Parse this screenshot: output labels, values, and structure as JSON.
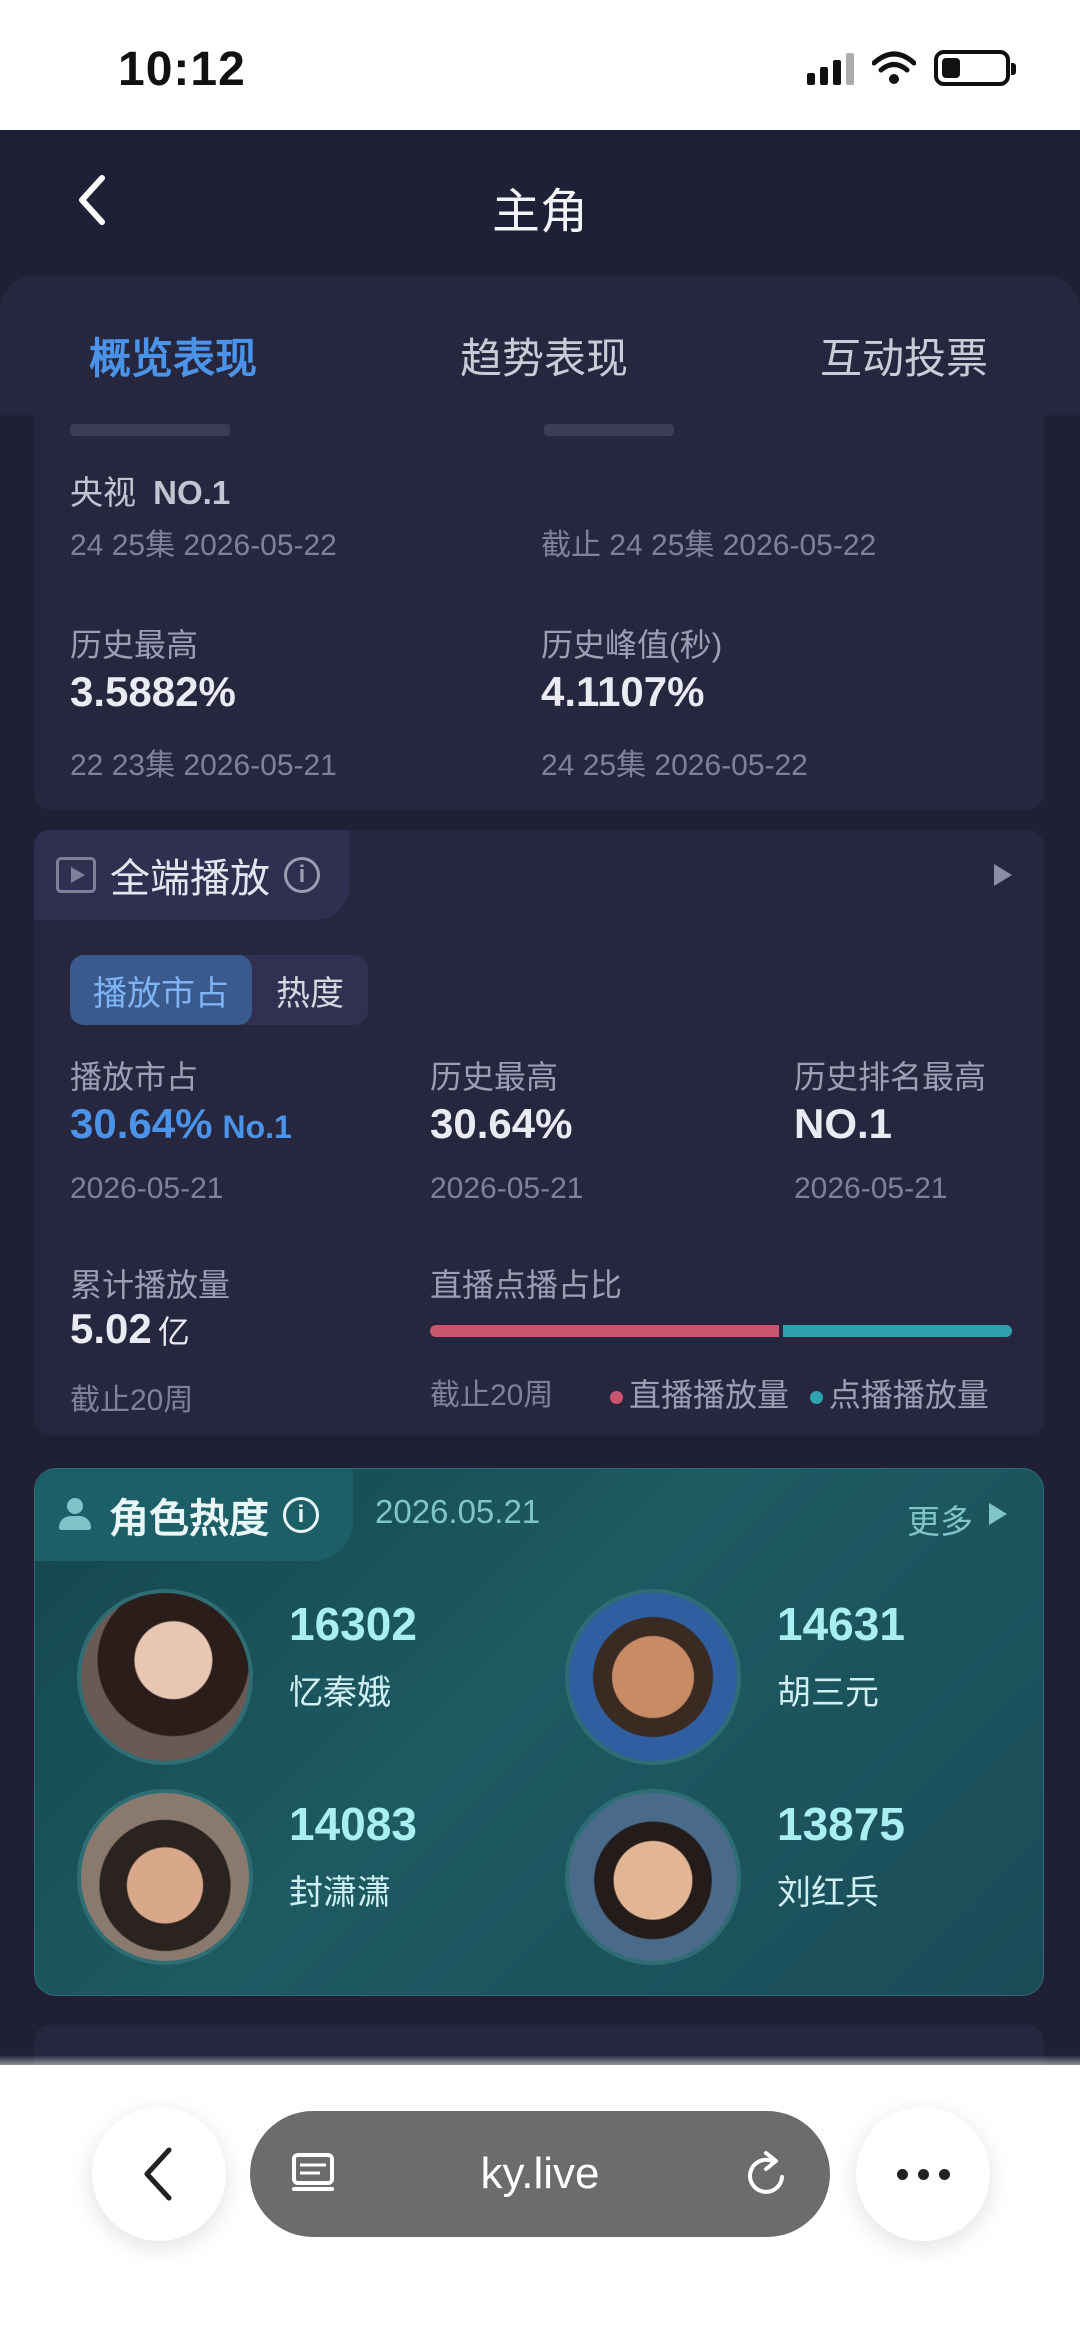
{
  "status": {
    "time": "10:12"
  },
  "header": {
    "title": "主角"
  },
  "tabs": [
    {
      "label": "概览表现",
      "active": true
    },
    {
      "label": "趋势表现",
      "active": false
    },
    {
      "label": "互动投票",
      "active": false
    }
  ],
  "ratings": {
    "left_rank_channel": "央视",
    "left_rank": "NO.1",
    "left_episode": "24 25集  2026-05-22",
    "right_episode": "截止 24 25集  2026-05-22",
    "hist_high_label": "历史最高",
    "hist_high_value": "3.5882%",
    "hist_high_sub": "22 23集  2026-05-21",
    "peak_label": "历史峰值(秒)",
    "peak_value": "4.1107%",
    "peak_sub": "24 25集  2026-05-22"
  },
  "play": {
    "section_title": "全端播放",
    "segment_on": "播放市占",
    "segment_off": "热度",
    "share_label": "播放市占",
    "share_value": "30.64%",
    "share_rank": "No.1",
    "share_date": "2026-05-21",
    "high_label": "历史最高",
    "high_value": "30.64%",
    "high_date": "2026-05-21",
    "rank_label": "历史排名最高",
    "rank_value": "NO.1",
    "rank_date": "2026-05-21",
    "total_label": "累计播放量",
    "total_value": "5.02",
    "total_unit": "亿",
    "total_sub": "截止20周",
    "ratio_label": "直播点播占比",
    "ratio_sub": "截止20周",
    "legend_live": "直播播放量",
    "legend_vod": "点播播放量",
    "live_fraction": 0.6
  },
  "roles": {
    "title": "角色热度",
    "date": "2026.05.21",
    "more": "更多",
    "items": [
      {
        "score": "16302",
        "name": "忆秦娥"
      },
      {
        "score": "14631",
        "name": "胡三元"
      },
      {
        "score": "14083",
        "name": "封潇潇"
      },
      {
        "score": "13875",
        "name": "刘红兵"
      }
    ]
  },
  "browser": {
    "url": "ky.live"
  },
  "colors": {
    "accent_blue": "#4b93e8",
    "live_red": "#c9566e",
    "vod_teal": "#2fa3ad",
    "role_card": "#1d5a62"
  }
}
